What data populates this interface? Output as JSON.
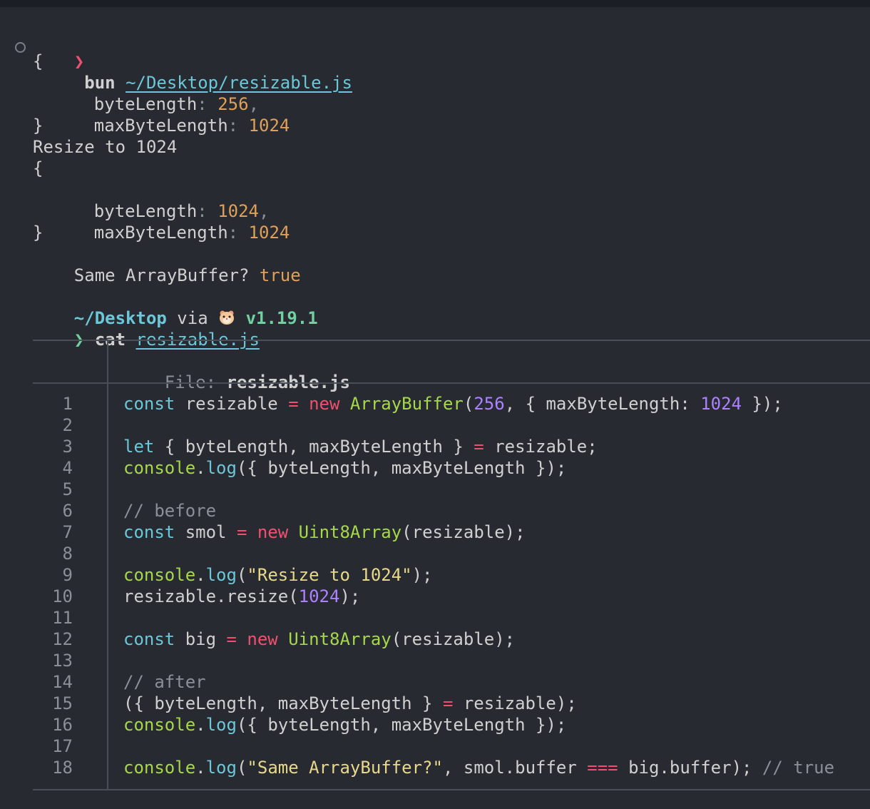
{
  "prompt": {
    "arrow": "❯",
    "cmd1": "bun",
    "arg1": "~/Desktop/resizable.js",
    "cmd2": "cat",
    "arg2": "resizable.js"
  },
  "output": {
    "brace_open": "{",
    "brace_close": "}",
    "key1": "byteLength",
    "key2": "maxByteLength",
    "colon": ":",
    "comma": ",",
    "before_byte": "256",
    "before_max": "1024",
    "resize_msg": "Resize to 1024",
    "after_byte": "1024",
    "after_max": "1024",
    "same_label": "Same ArrayBuffer?",
    "same_value": "true"
  },
  "status": {
    "dir": "~/Desktop",
    "via": "via",
    "version": "v1.19.1",
    "runtime_icon": "hamster-icon"
  },
  "viewer": {
    "file_label": "File:",
    "file_name": "resizable.js",
    "line_numbers": [
      "1",
      "2",
      "3",
      "4",
      "5",
      "6",
      "7",
      "8",
      "9",
      "10",
      "11",
      "12",
      "13",
      "14",
      "15",
      "16",
      "17",
      "18"
    ],
    "code": {
      "l1": {
        "a": "const",
        "b": " resizable ",
        "c": "=",
        "d": " ",
        "e": "new",
        "f": " ",
        "g": "ArrayBuffer",
        "h": "(",
        "i": "256",
        "j": ", { maxByteLength: ",
        "k": "1024",
        "l": " });"
      },
      "l3": {
        "a": "let",
        "b": " { byteLength, maxByteLength } ",
        "c": "=",
        "d": " resizable;"
      },
      "l4": {
        "a": "console",
        "b": ".",
        "c": "log",
        "d": "({ byteLength, maxByteLength });"
      },
      "l6": "// before",
      "l7": {
        "a": "const",
        "b": " smol ",
        "c": "=",
        "d": " ",
        "e": "new",
        "f": " ",
        "g": "Uint8Array",
        "h": "(resizable);"
      },
      "l9": {
        "a": "console",
        "b": ".",
        "c": "log",
        "d": "(",
        "e": "\"Resize to 1024\"",
        "f": ");"
      },
      "l10": {
        "a": "resizable.resize(",
        "b": "1024",
        "c": ");"
      },
      "l12": {
        "a": "const",
        "b": " big ",
        "c": "=",
        "d": " ",
        "e": "new",
        "f": " ",
        "g": "Uint8Array",
        "h": "(resizable);"
      },
      "l14": "// after",
      "l15": {
        "a": "({ byteLength, maxByteLength } ",
        "b": "=",
        "c": " resizable);"
      },
      "l16": {
        "a": "console",
        "b": ".",
        "c": "log",
        "d": "({ byteLength, maxByteLength });"
      },
      "l18": {
        "a": "console",
        "b": ".",
        "c": "log",
        "d": "(",
        "e": "\"Same ArrayBuffer?\"",
        "f": ", smol.buffer ",
        "g": "===",
        "h": " big.buffer); ",
        "i": "// true"
      }
    }
  }
}
